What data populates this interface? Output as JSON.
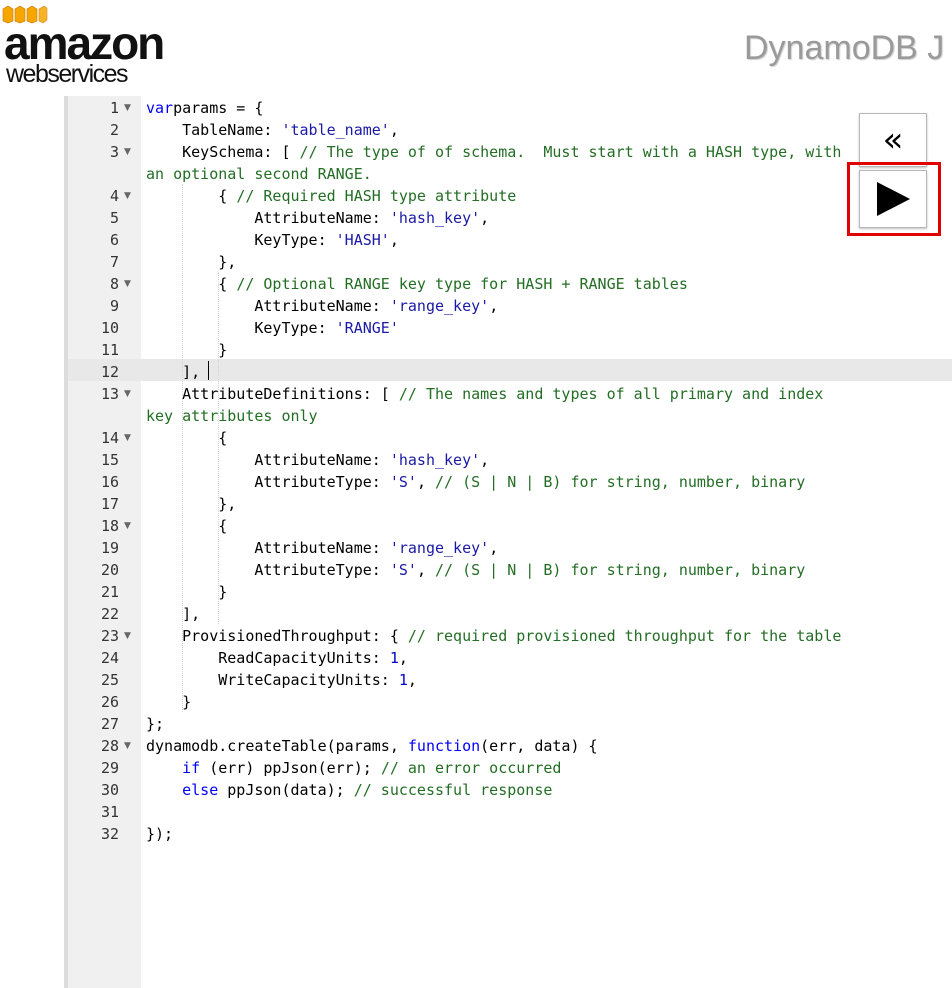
{
  "header": {
    "logo_line1": "amazon",
    "logo_line2": "webservices",
    "app_title": "DynamoDB J",
    "logo_color": "#f7a600"
  },
  "toolbar": {
    "back_icon": "double-chevron-left-icon",
    "back_glyph": "«",
    "run_icon": "play-icon",
    "highlight_color": "#e00000"
  },
  "editor": {
    "active_line": "12",
    "line_numbers": [
      "1",
      "2",
      "3",
      "4",
      "5",
      "6",
      "7",
      "8",
      "9",
      "10",
      "11",
      "12",
      "13",
      "14",
      "15",
      "16",
      "17",
      "18",
      "19",
      "20",
      "21",
      "22",
      "23",
      "24",
      "25",
      "26",
      "27",
      "28",
      "29",
      "30",
      "31",
      "32"
    ],
    "lines": [
      [
        [
          "kw",
          "var"
        ],
        [
          "",
          "params = {"
        ]
      ],
      [
        [
          "",
          "    TableName: "
        ],
        [
          "str",
          "'table_name'"
        ],
        [
          "",
          ","
        ]
      ],
      [
        [
          "",
          "    KeySchema: [ "
        ],
        [
          "cm",
          "// The type of of schema.  Must start with a HASH type, with"
        ]
      ],
      [
        [
          "cm",
          "an optional second RANGE."
        ]
      ],
      [
        [
          "",
          "        { "
        ],
        [
          "cm",
          "// Required HASH type attribute"
        ]
      ],
      [
        [
          "",
          "            AttributeName: "
        ],
        [
          "str",
          "'hash_key'"
        ],
        [
          "",
          ","
        ]
      ],
      [
        [
          "",
          "            KeyType: "
        ],
        [
          "str",
          "'HASH'"
        ],
        [
          "",
          ","
        ]
      ],
      [
        [
          "",
          "        },"
        ]
      ],
      [
        [
          "",
          "        { "
        ],
        [
          "cm",
          "// Optional RANGE key type for HASH + RANGE tables"
        ]
      ],
      [
        [
          "",
          "            AttributeName: "
        ],
        [
          "str",
          "'range_key'"
        ],
        [
          "",
          ","
        ]
      ],
      [
        [
          "",
          "            KeyType: "
        ],
        [
          "str",
          "'RANGE'"
        ]
      ],
      [
        [
          "",
          "        }"
        ]
      ],
      [
        [
          "",
          "    ],"
        ]
      ],
      [
        [
          "",
          "    AttributeDefinitions: [ "
        ],
        [
          "cm",
          "// The names and types of all primary and index"
        ]
      ],
      [
        [
          "cm",
          "key attributes only"
        ]
      ],
      [
        [
          "",
          "        {"
        ]
      ],
      [
        [
          "",
          "            AttributeName: "
        ],
        [
          "str",
          "'hash_key'"
        ],
        [
          "",
          ","
        ]
      ],
      [
        [
          "",
          "            AttributeType: "
        ],
        [
          "str",
          "'S'"
        ],
        [
          "",
          ", "
        ],
        [
          "cm",
          "// (S | N | B) for string, number, binary"
        ]
      ],
      [
        [
          "",
          "        },"
        ]
      ],
      [
        [
          "",
          "        {"
        ]
      ],
      [
        [
          "",
          "            AttributeName: "
        ],
        [
          "str",
          "'range_key'"
        ],
        [
          "",
          ","
        ]
      ],
      [
        [
          "",
          "            AttributeType: "
        ],
        [
          "str",
          "'S'"
        ],
        [
          "",
          ", "
        ],
        [
          "cm",
          "// (S | N | B) for string, number, binary"
        ]
      ],
      [
        [
          "",
          "        }"
        ]
      ],
      [
        [
          "",
          "    ],"
        ]
      ],
      [
        [
          "",
          "    ProvisionedThroughput: { "
        ],
        [
          "cm",
          "// required provisioned throughput for the table"
        ]
      ],
      [
        [
          "",
          "        ReadCapacityUnits: "
        ],
        [
          "num",
          "1"
        ],
        [
          "",
          ","
        ]
      ],
      [
        [
          "",
          "        WriteCapacityUnits: "
        ],
        [
          "num",
          "1"
        ],
        [
          "",
          ","
        ]
      ],
      [
        [
          "",
          "    }"
        ]
      ],
      [
        [
          "",
          "};"
        ]
      ],
      [
        [
          "",
          "dynamodb.createTable(params, "
        ],
        [
          "kw",
          "function"
        ],
        [
          "",
          "(err, data) {"
        ]
      ],
      [
        [
          "",
          "    "
        ],
        [
          "kw",
          "if"
        ],
        [
          "",
          " (err) ppJson(err); "
        ],
        [
          "cm",
          "// an error occurred"
        ]
      ],
      [
        [
          "",
          "    "
        ],
        [
          "kw",
          "else"
        ],
        [
          "",
          " ppJson(data); "
        ],
        [
          "cm",
          "// successful response"
        ]
      ],
      [
        [
          "",
          ""
        ]
      ],
      [
        [
          "",
          "});"
        ]
      ]
    ]
  }
}
